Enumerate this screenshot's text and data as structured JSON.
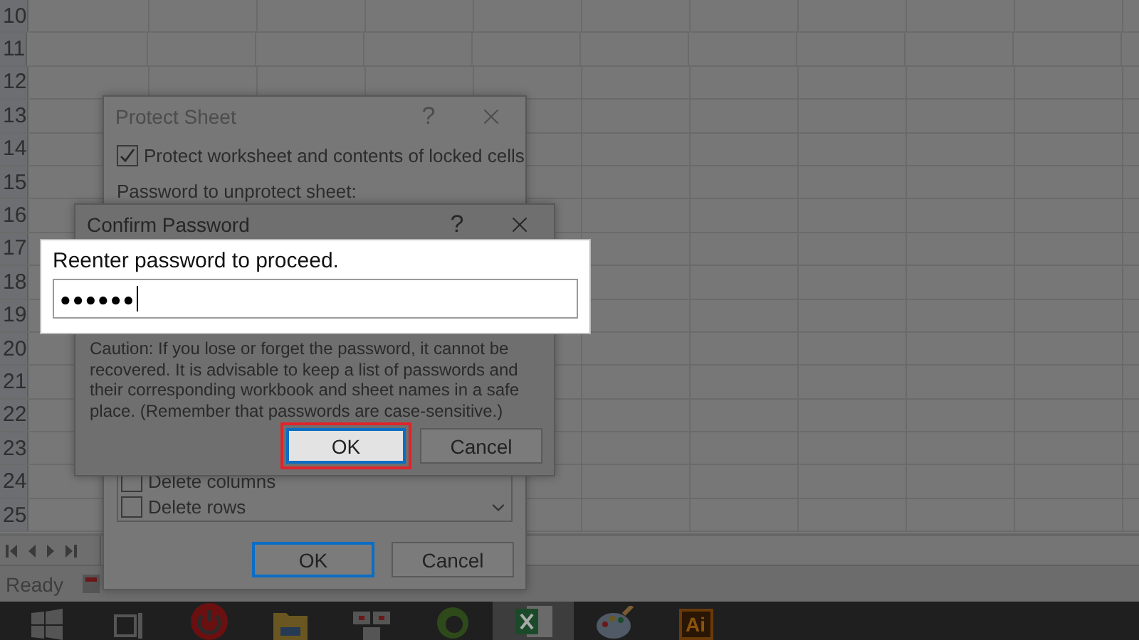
{
  "sheet": {
    "rows": [
      "10",
      "11",
      "12",
      "13",
      "14",
      "15",
      "16",
      "17",
      "18",
      "19",
      "20",
      "21",
      "22",
      "23",
      "24",
      "25"
    ]
  },
  "status_bar": {
    "text": "Ready"
  },
  "protect_dialog": {
    "title": "Protect Sheet",
    "help": "?",
    "protect_option": {
      "label": "Protect worksheet and contents of locked cells",
      "checked": true
    },
    "password_label": "Password to unprotect sheet:",
    "permissions": [
      {
        "label": "Delete columns",
        "checked": false
      },
      {
        "label": "Delete rows",
        "checked": false
      }
    ],
    "buttons": [
      {
        "label": "OK",
        "default": true
      },
      {
        "label": "Cancel",
        "default": false
      }
    ]
  },
  "confirm_dialog": {
    "title": "Confirm Password",
    "help": "?",
    "prompt": "Reenter password to proceed.",
    "password": "●●●●●●",
    "caution": "Caution: If you lose or forget the password, it cannot be recovered. It is advisable to keep a list of passwords and their corresponding workbook and sheet names in a safe place.  (Remember that passwords are case-sensitive.)",
    "buttons": [
      {
        "label": "OK",
        "focused": true
      },
      {
        "label": "Cancel",
        "focused": false
      }
    ]
  },
  "taskbar": {
    "items": [
      {
        "kind": "start",
        "selected": false
      },
      {
        "kind": "taskview",
        "selected": false
      },
      {
        "kind": "power",
        "selected": false
      },
      {
        "kind": "folder",
        "selected": false
      },
      {
        "kind": "unikey",
        "selected": false
      },
      {
        "kind": "green",
        "selected": false
      },
      {
        "kind": "excel",
        "selected": true
      },
      {
        "kind": "paint",
        "selected": false
      },
      {
        "kind": "ai",
        "label": "Ai",
        "selected": false
      }
    ]
  }
}
